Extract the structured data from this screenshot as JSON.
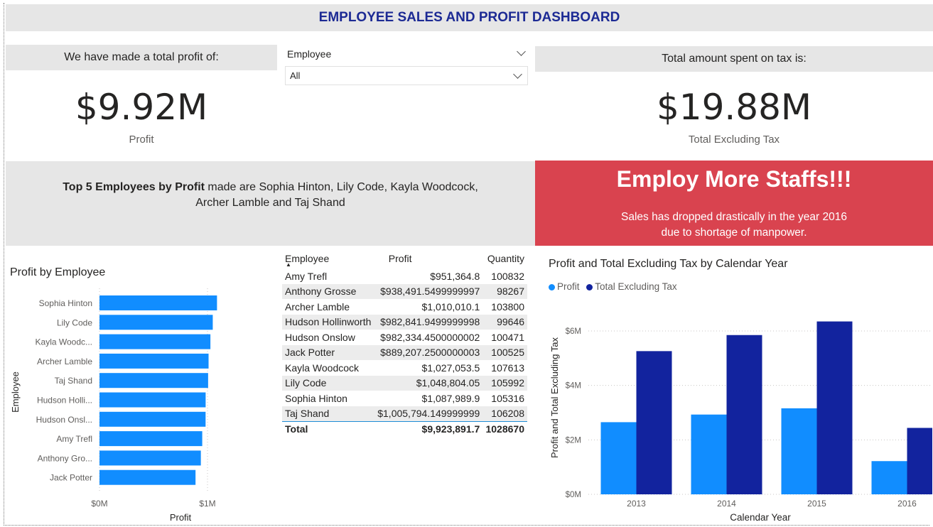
{
  "header": {
    "title": "EMPLOYEE SALES AND PROFIT DASHBOARD"
  },
  "profit_card": {
    "heading": "We have made a total profit of:",
    "value": "$9.92M",
    "label": "Profit"
  },
  "slicer": {
    "label": "Employee",
    "selected": "All"
  },
  "tax_card": {
    "heading": "Total amount spent on tax is:",
    "value": "$19.88M",
    "label": "Total Excluding Tax"
  },
  "top5": {
    "bold": "Top 5 Employees by Profit",
    "rest_line1": " made are Sophia Hinton, Lily Code, Kayla Woodcock,",
    "line2": "Archer Lamble and Taj Shand"
  },
  "alert": {
    "headline": "Employ More Staffs!!!",
    "line1": "Sales has dropped drastically in the year 2016",
    "line2": "due to shortage of manpower."
  },
  "colors": {
    "accent": "#1c2a94",
    "profit_bar": "#118dff",
    "tax_bar": "#12239e",
    "alert": "#d9434f",
    "panel": "#e6e6e6"
  },
  "table": {
    "columns": [
      "Employee",
      "Profit",
      "Quantity"
    ],
    "rows": [
      [
        "Amy Trefl",
        "$951,364.8",
        "100832"
      ],
      [
        "Anthony Grosse",
        "$938,491.5499999997",
        "98267"
      ],
      [
        "Archer Lamble",
        "$1,010,010.1",
        "103800"
      ],
      [
        "Hudson Hollinworth",
        "$982,841.9499999998",
        "99646"
      ],
      [
        "Hudson Onslow",
        "$982,334.4500000002",
        "100471"
      ],
      [
        "Jack Potter",
        "$889,207.2500000003",
        "100525"
      ],
      [
        "Kayla Woodcock",
        "$1,027,053.5",
        "107613"
      ],
      [
        "Lily Code",
        "$1,048,804.05",
        "105992"
      ],
      [
        "Sophia Hinton",
        "$1,087,989.9",
        "105316"
      ],
      [
        "Taj Shand",
        "$1,005,794.149999999",
        "106208"
      ]
    ],
    "total": [
      "Total",
      "$9,923,891.7",
      "1028670"
    ]
  },
  "chart_data": [
    {
      "type": "bar",
      "orientation": "horizontal",
      "title": "Profit by Employee",
      "xlabel": "Profit",
      "ylabel": "Employee",
      "categories": [
        "Sophia Hinton",
        "Lily Code",
        "Kayla Woodc...",
        "Archer Lamble",
        "Taj Shand",
        "Hudson Holli...",
        "Hudson Onsl...",
        "Amy Trefl",
        "Anthony Gro...",
        "Jack Potter"
      ],
      "values": [
        1087989.9,
        1048804.05,
        1027053.5,
        1010010.1,
        1005794.15,
        982841.95,
        982334.45,
        951364.8,
        938491.55,
        889207.25
      ],
      "xticks": [
        "$0M",
        "$1M"
      ],
      "xlim": [
        0,
        1000000
      ],
      "grid": true,
      "color": "#118dff"
    },
    {
      "type": "bar",
      "title": "Profit and Total Excluding Tax by Calendar Year",
      "xlabel": "Calendar Year",
      "ylabel": "Profit and Total Excluding Tax",
      "categories": [
        "2013",
        "2014",
        "2015",
        "2016"
      ],
      "series": [
        {
          "name": "Profit",
          "values": [
            2.65,
            2.93,
            3.16,
            1.22
          ],
          "color": "#118dff"
        },
        {
          "name": "Total Excluding Tax",
          "values": [
            5.26,
            5.85,
            6.35,
            2.44
          ],
          "color": "#12239e"
        }
      ],
      "yticks": [
        "$0M",
        "$2M",
        "$4M",
        "$6M"
      ],
      "ylim": [
        0,
        6
      ],
      "legend": "top-left",
      "grid": true
    }
  ]
}
